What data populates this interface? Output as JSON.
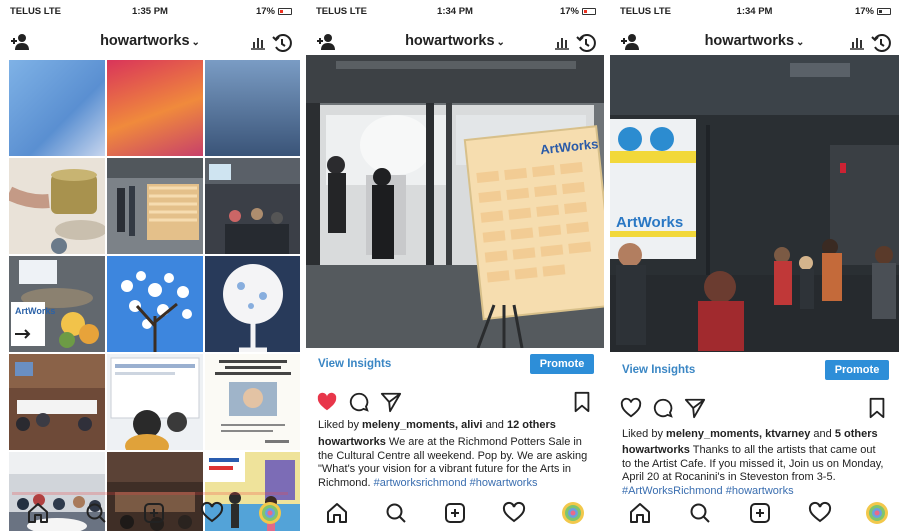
{
  "screens": [
    {
      "status": {
        "carrier": "TELUS  LTE",
        "time": "1:35 PM",
        "battery": "17%"
      },
      "header": {
        "username": "howartworks"
      },
      "grid_tiles": 15
    },
    {
      "status": {
        "carrier": "TELUS  LTE",
        "time": "1:34 PM",
        "battery": "17%"
      },
      "header": {
        "username": "howartworks"
      },
      "photo": {
        "sign_text": "ArtWorks"
      },
      "insights_label": "View Insights",
      "promote_label": "Promote",
      "liked": true,
      "likes": {
        "prefix": "Liked by",
        "names": "meleny_moments, alivi",
        "joiner": "and",
        "others": "12 others"
      },
      "caption": {
        "username": "howartworks",
        "text": "We are at the Richmond Potters Sale in the Cultural Centre all weekend. Pop by. We are asking \"What's your vision for a vibrant future for the Arts in Richmond.",
        "hashtags": "#artworksrichmond #howartworks"
      }
    },
    {
      "status": {
        "carrier": "TELUS  LTE",
        "time": "1:34 PM",
        "battery": "17%"
      },
      "header": {
        "username": "howartworks"
      },
      "photo": {
        "screen_text": "ArtWorks"
      },
      "insights_label": "View Insights",
      "promote_label": "Promote",
      "liked": false,
      "likes": {
        "prefix": "Liked by",
        "names": "meleny_moments, ktvarney",
        "joiner": "and",
        "others": "5 others"
      },
      "caption": {
        "username": "howartworks",
        "text": "Thanks to all the artists that came out to the Artist Cafe. If you missed it, Join us on Monday, April 20 at Rocanini's in Steveston from 3-5.",
        "hashtags": "#ArtWorksRichmond #howartworks"
      }
    }
  ],
  "colors": {
    "link": "#3a86c4",
    "promote": "#2d8ed8",
    "like": "#e8364a",
    "hashtag": "#3a6eb0"
  },
  "icons": [
    "add-user-icon",
    "chevron-down-icon",
    "insights-icon",
    "archive-icon",
    "heart-icon",
    "comment-icon",
    "share-icon",
    "bookmark-icon",
    "home-icon",
    "search-icon",
    "new-post-icon",
    "activity-icon",
    "profile-icon"
  ]
}
